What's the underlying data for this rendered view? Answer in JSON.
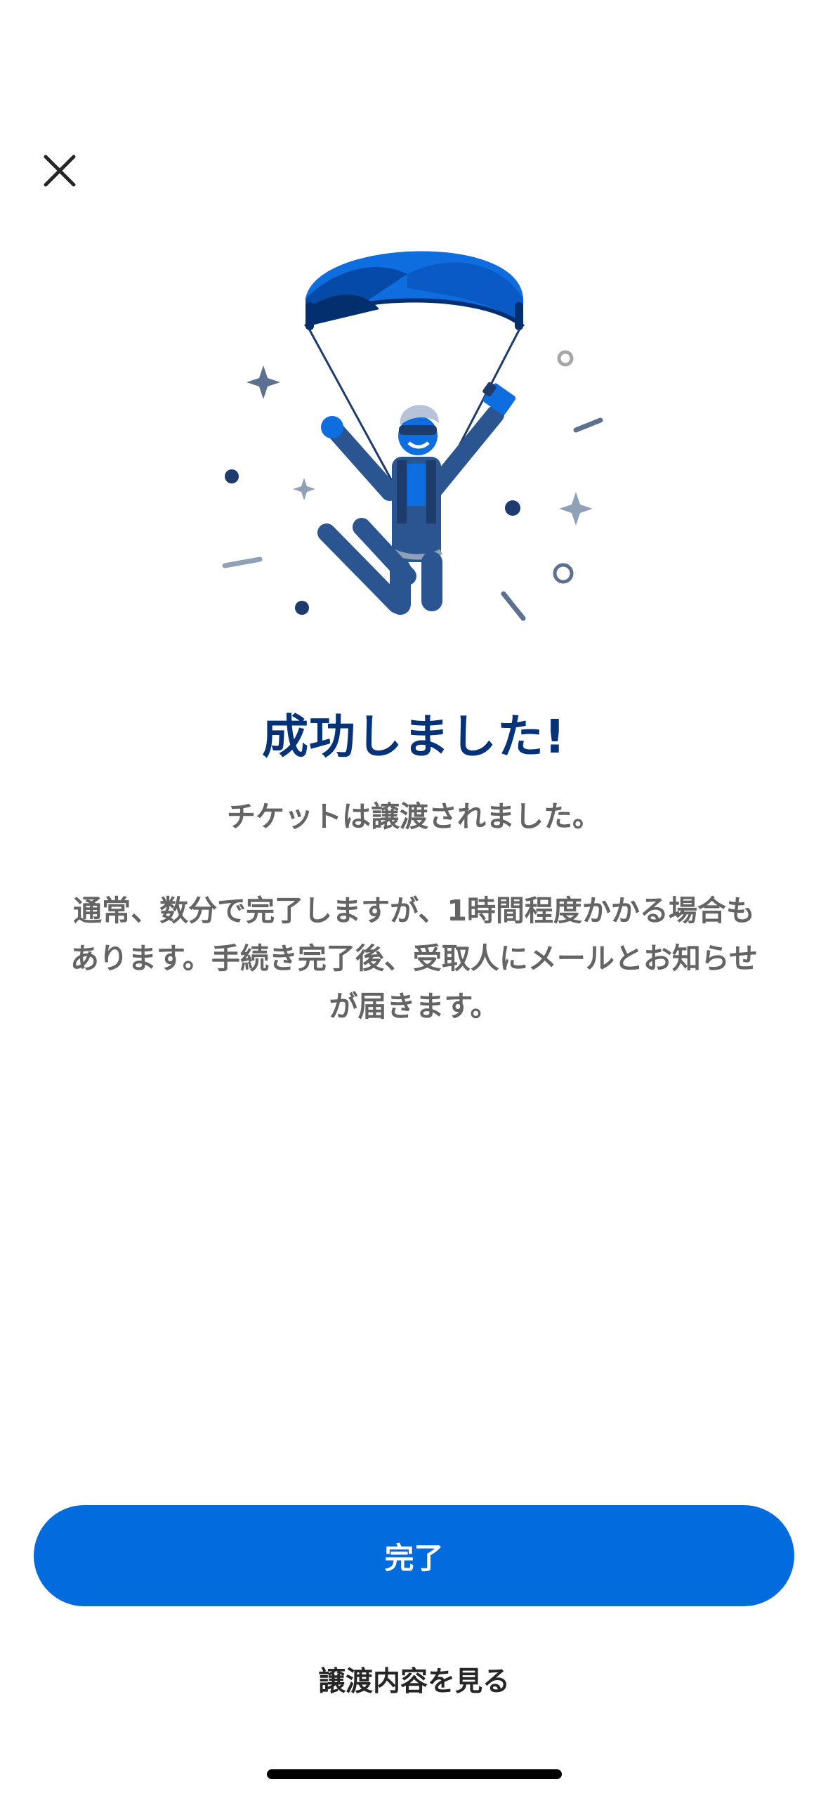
{
  "header": {
    "close_icon": "close-icon"
  },
  "illustration": {
    "icon": "parachute-success-illustration",
    "colors": {
      "canopy_light": "#0e6ee0",
      "canopy_dark": "#063a88",
      "figure": "#2a5591",
      "accent": "#8fa0b8"
    }
  },
  "content": {
    "title": "成功しました!",
    "subtitle": "チケットは譲渡されました。",
    "body_lines": [
      "通常、数分で完了しますが、1時間程度かかる場合も",
      "あります。手続き完了後、受取人にメールとお知らせ",
      "が届きます。"
    ]
  },
  "actions": {
    "done_label": "完了",
    "view_details_label": "譲渡内容を見る"
  },
  "colors": {
    "primary": "#026cdf",
    "title": "#063377",
    "body_text": "#646464"
  }
}
